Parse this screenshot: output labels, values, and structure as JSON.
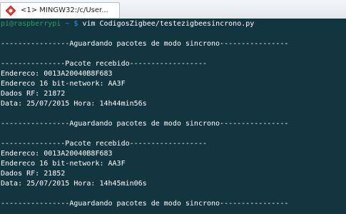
{
  "window": {
    "tab_title": "<1> MINGW32:/c/User..."
  },
  "terminal": {
    "prompt": {
      "user_host": "pi@raspberrypi",
      "path": "~",
      "symbol": "$",
      "command": "vim CodigosZigbee/testezigbeesincrono.py"
    },
    "lines": [
      "",
      "----------------Aguardando pacotes de modo sincrono----------------",
      "",
      "---------------Pacote recebido------------------",
      "Endereco: 0013A20040B8F683",
      "Endereco 16 bit-network: AA3F",
      "Dados RF: 21872",
      "Data: 25/07/2015 Hora: 14h44min56s",
      "",
      "----------------Aguardando pacotes de modo sincrono----------------",
      "",
      "---------------Pacote recebido------------------",
      "Endereco: 0013A20040B8F683",
      "Endereco 16 bit-network: AA3F",
      "Dados RF: 21852",
      "Data: 25/07/2015 Hora: 14h45min06s",
      "",
      "----------------Aguardando pacotes de modo sincrono----------------"
    ]
  }
}
